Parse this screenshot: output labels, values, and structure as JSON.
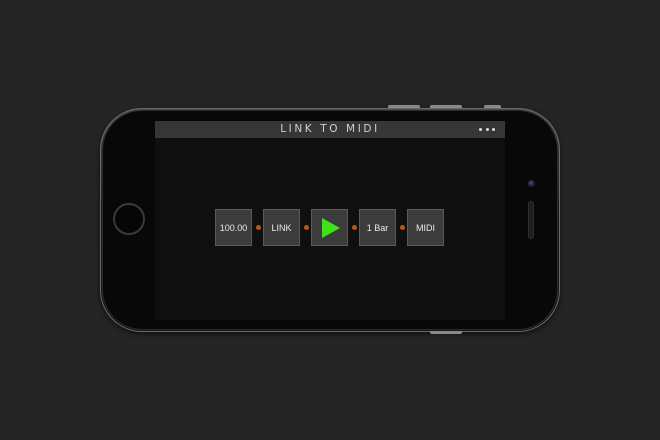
{
  "app": {
    "title": "LINK TO MIDI",
    "menu_icon": "more-horizontal-icon"
  },
  "chain": {
    "tempo": "100.00",
    "link": "LINK",
    "play_icon": "play-icon",
    "quantum": "1 Bar",
    "midi": "MIDI"
  },
  "colors": {
    "background": "#252525",
    "screen": "#0f0f0f",
    "title_bar": "#363636",
    "box": "#3c3c3c",
    "connector": "#c0531c",
    "play": "#3ee31c"
  }
}
